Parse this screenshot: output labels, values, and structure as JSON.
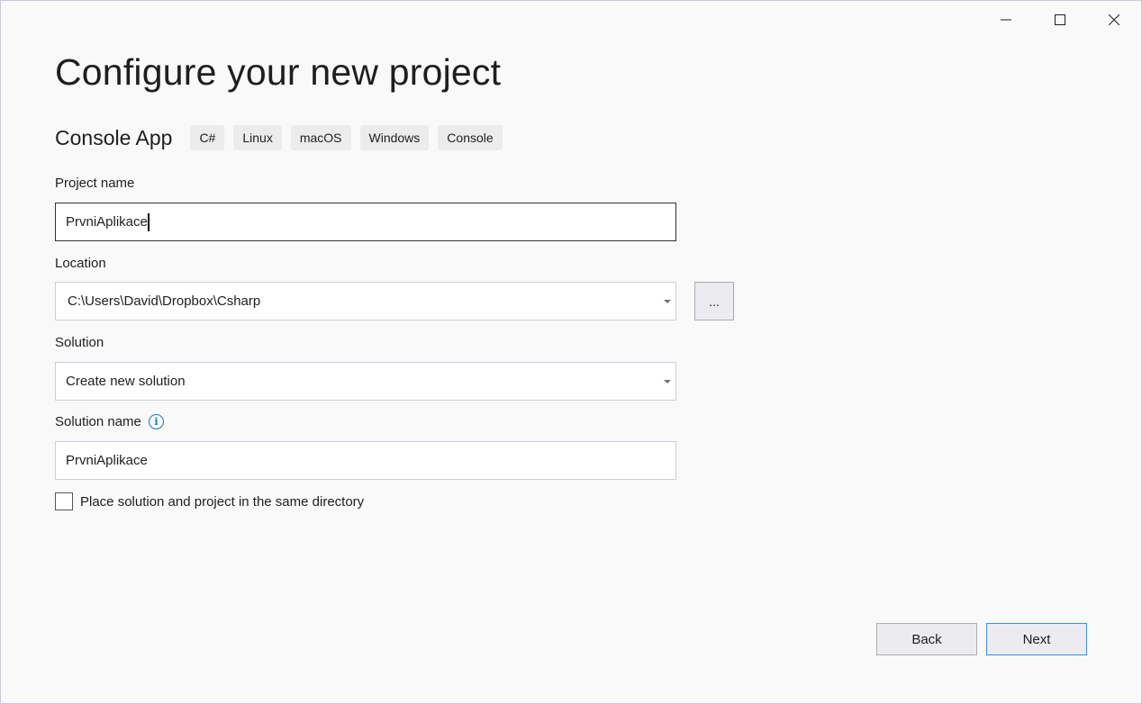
{
  "window": {
    "controls": [
      {
        "name": "minimize",
        "icon": "minimize-icon"
      },
      {
        "name": "maximize",
        "icon": "maximize-icon"
      },
      {
        "name": "close",
        "icon": "close-icon"
      }
    ]
  },
  "header": {
    "title": "Configure your new project",
    "template_name": "Console App",
    "tags": [
      "C#",
      "Linux",
      "macOS",
      "Windows",
      "Console"
    ]
  },
  "form": {
    "project_name": {
      "label": "Project name",
      "value": "PrvniAplikace"
    },
    "location": {
      "label": "Location",
      "value": "C:\\Users\\David\\Dropbox\\Csharp",
      "browse_label": "..."
    },
    "solution": {
      "label": "Solution",
      "value": "Create new solution"
    },
    "solution_name": {
      "label": "Solution name",
      "info_icon": "i",
      "value": "PrvniAplikace"
    },
    "same_directory": {
      "label": "Place solution and project in the same directory",
      "checked": false
    }
  },
  "footer": {
    "back_label": "Back",
    "next_label": "Next"
  }
}
